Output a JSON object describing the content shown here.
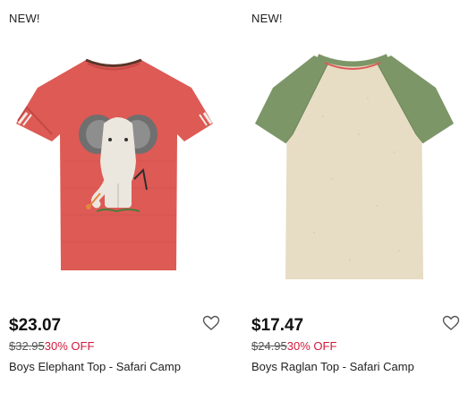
{
  "products": [
    {
      "badge": "NEW!",
      "price": "$23.07",
      "original_price": "$32.95",
      "discount": "30% OFF",
      "name": "Boys Elephant Top - Safari Camp",
      "image_icon": "elephant-tshirt-image",
      "colors": {
        "shirt": "#dd5a55",
        "accent": "#f2ece6"
      }
    },
    {
      "badge": "NEW!",
      "price": "$17.47",
      "original_price": "$24.95",
      "discount": "30% OFF",
      "name": "Boys Raglan Top - Safari Camp",
      "image_icon": "raglan-tshirt-image",
      "colors": {
        "body": "#e7dcc4",
        "sleeves": "#7d9668"
      }
    }
  ],
  "favorite_icon": "heart-icon",
  "colors": {
    "sale_red": "#d0193c",
    "text": "#1a1a1a"
  }
}
